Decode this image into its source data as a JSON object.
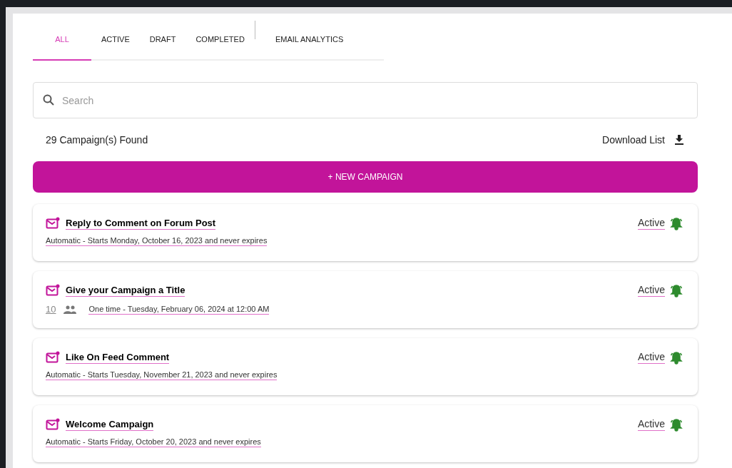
{
  "tabs": [
    {
      "label": "ALL",
      "selected": true
    },
    {
      "label": "ACTIVE",
      "selected": false
    },
    {
      "label": "DRAFT",
      "selected": false
    },
    {
      "label": "COMPLETED",
      "selected": false
    },
    {
      "label": "EMAIL ANALYTICS",
      "selected": false
    }
  ],
  "search": {
    "placeholder": "Search"
  },
  "results_count": "29 Campaign(s) Found",
  "download_link": "Download List",
  "new_campaign_button": "+ NEW CAMPAIGN",
  "campaigns": [
    {
      "title": "Reply to Comment on Forum Post",
      "schedule": "Automatic - Starts Monday, October 16, 2023 and never expires",
      "status": "Active"
    },
    {
      "title": "Give your Campaign a Title",
      "recipients": "10",
      "schedule": "One time - Tuesday, February 06, 2024 at 12:00 AM",
      "status": "Active"
    },
    {
      "title": "Like On Feed Comment",
      "schedule": "Automatic - Starts Tuesday, November 21, 2023 and never expires",
      "status": "Active"
    },
    {
      "title": "Welcome Campaign",
      "schedule": "Automatic - Starts Friday, October 20, 2023 and never expires",
      "status": "Active"
    }
  ]
}
